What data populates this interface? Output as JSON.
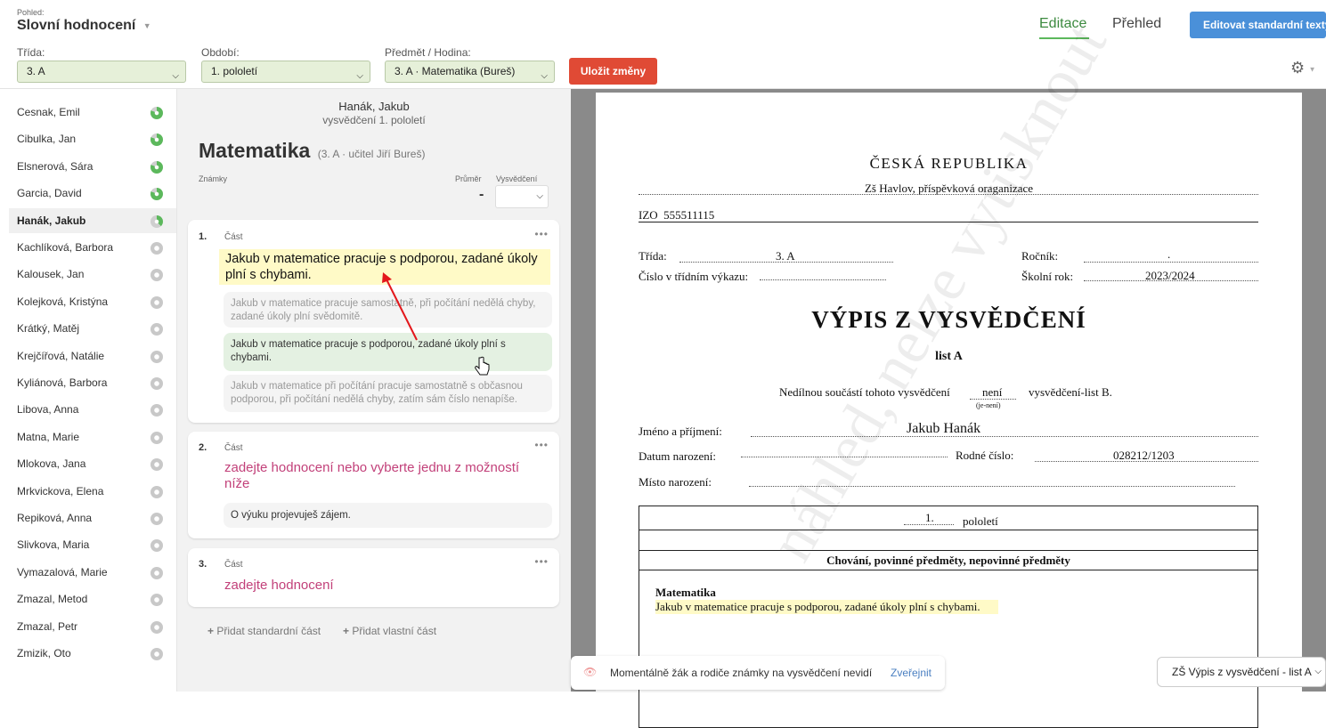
{
  "header": {
    "view_label": "Pohled:",
    "view_value": "Slovní hodnocení",
    "tab_edit": "Editace",
    "tab_overview": "Přehled",
    "edit_texts_button": "Editovat standardní texty",
    "class_label": "Třída:",
    "class_value": "3. A",
    "period_label": "Období:",
    "period_value": "1. pololetí",
    "subject_label": "Předmět / Hodina:",
    "subject_value": "3. A · Matematika (Bureš)",
    "save_button": "Uložit změny"
  },
  "students": [
    {
      "name": "Cesnak, Emil",
      "status": "full"
    },
    {
      "name": "Cibulka, Jan",
      "status": "full"
    },
    {
      "name": "Elsnerová, Sára",
      "status": "full"
    },
    {
      "name": "Garcia, David",
      "status": "full"
    },
    {
      "name": "Hanák, Jakub",
      "status": "partial"
    },
    {
      "name": "Kachlíková, Barbora",
      "status": "none"
    },
    {
      "name": "Kalousek, Jan",
      "status": "none"
    },
    {
      "name": "Kolejková, Kristýna",
      "status": "none"
    },
    {
      "name": "Krátký, Matěj",
      "status": "none"
    },
    {
      "name": "Krejčířová, Natálie",
      "status": "none"
    },
    {
      "name": "Kyliánová, Barbora",
      "status": "none"
    },
    {
      "name": "Libova, Anna",
      "status": "none"
    },
    {
      "name": "Matna, Marie",
      "status": "none"
    },
    {
      "name": "Mlokova, Jana",
      "status": "none"
    },
    {
      "name": "Mrkvickova, Elena",
      "status": "none"
    },
    {
      "name": "Repiková, Anna",
      "status": "none"
    },
    {
      "name": "Slivkova, Maria",
      "status": "none"
    },
    {
      "name": "Vymazalová, Marie",
      "status": "none"
    },
    {
      "name": "Zmazal, Metod",
      "status": "none"
    },
    {
      "name": "Zmazal, Petr",
      "status": "none"
    },
    {
      "name": "Zmizik, Oto",
      "status": "none"
    }
  ],
  "editor": {
    "student_name": "Hanák, Jakub",
    "report_label": "vysvědčení 1. pololetí",
    "subject_title": "Matematika",
    "subject_meta": "(3. A · učitel Jiří Bureš)",
    "grades_label": "Známky",
    "avg_label": "Průměr",
    "avg_value": "-",
    "cert_label": "Vysvědčení",
    "part_label": "Část",
    "part1_num": "1.",
    "part1_text": "Jakub v matematice pracuje s podporou, zadané úkoly plní s chybami.",
    "part1_opt1": "Jakub v matematice pracuje samostatně, při počítání nedělá chyby, zadané úkoly plní svědomitě.",
    "part1_opt2": "Jakub v matematice pracuje s podporou, zadané úkoly plní s chybami.",
    "part1_opt3": "Jakub v matematice při počítání pracuje samostatně s občasnou podporou, při počítání nedělá chyby, zatím sám číslo nenapíše.",
    "part2_num": "2.",
    "part2_placeholder": "zadejte hodnocení nebo vyberte jednu z možností níže",
    "part2_opt1": "O výuku projevuješ zájem.",
    "part3_num": "3.",
    "part3_placeholder": "zadejte hodnocení",
    "add_standard": "Přidat standardní část",
    "add_custom": "Přidat vlastní část",
    "notice_text": "Momentálně žák a rodiče známky na vysvědčení nevidí",
    "publish_link": "Zveřejnit"
  },
  "document": {
    "country": "ČESKÁ REPUBLIKA",
    "school": "Zš Havlov, příspěvková oraganizace",
    "izo_label": "IZO",
    "izo_value": "555511115",
    "class_label": "Třída:",
    "class_value": "3. A",
    "grade_label": "Ročník:",
    "grade_value": ".",
    "register_label": "Číslo v třídním výkazu:",
    "school_year_label": "Školní rok:",
    "school_year_value": "2023/2024",
    "title": "VÝPIS Z VYSVĚDČENÍ",
    "sheet": "list A",
    "integral_text": "Nedílnou součástí tohoto vysvědčení",
    "integral_value": "není",
    "integral_hint": "(je-není)",
    "integral_suffix": "vysvědčení-list B.",
    "name_label": "Jméno a příjmení:",
    "name_value": "Jakub Hanák",
    "dob_label": "Datum narození:",
    "birth_no_label": "Rodné číslo:",
    "birth_no_value": "028212/1203",
    "birthplace_label": "Místo narození:",
    "term_value": "1.",
    "term_label": "pololetí",
    "section_header": "Chování, povinné předměty, nepovinné předměty",
    "subject_name": "Matematika",
    "subject_text": "Jakub v matematice pracuje s podporou, zadané úkoly plní s chybami.",
    "watermark": "náhled, nelze vytisknout",
    "template_select": "ZŠ Výpis z vysvědčení - list A"
  },
  "colors": {
    "accent_green": "#5cb85c",
    "save_red": "#e04a35",
    "blue_button": "#4a90d9",
    "pink_placeholder": "#c2417a",
    "highlight_yellow": "#fffac7"
  }
}
